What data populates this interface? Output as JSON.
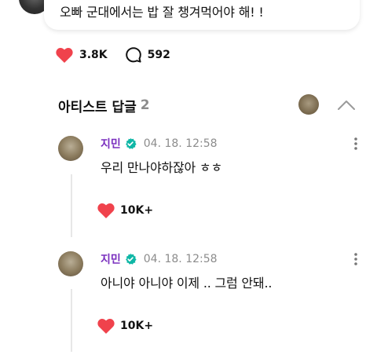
{
  "post": {
    "text": "오빠 군대에서는 밥 잘 챙겨먹어야 해! !"
  },
  "reactions": {
    "likes": "3.8K",
    "comments": "592"
  },
  "artist_replies": {
    "title": "아티스트 답글",
    "count": "2"
  },
  "replies": [
    {
      "author": "지민",
      "timestamp": "04. 18. 12:58",
      "text": "우리 만나야하잖아 ㅎㅎ",
      "likes": "10K+"
    },
    {
      "author": "지민",
      "timestamp": "04. 18. 12:58",
      "text": "아니야 아니야 이제 .. 그럼 안돼..",
      "likes": "10K+"
    }
  ],
  "colors": {
    "heart": "#f0424c",
    "author": "#7a2fbf",
    "verified": "#0fb7a6",
    "muted": "#8c8c8c"
  }
}
